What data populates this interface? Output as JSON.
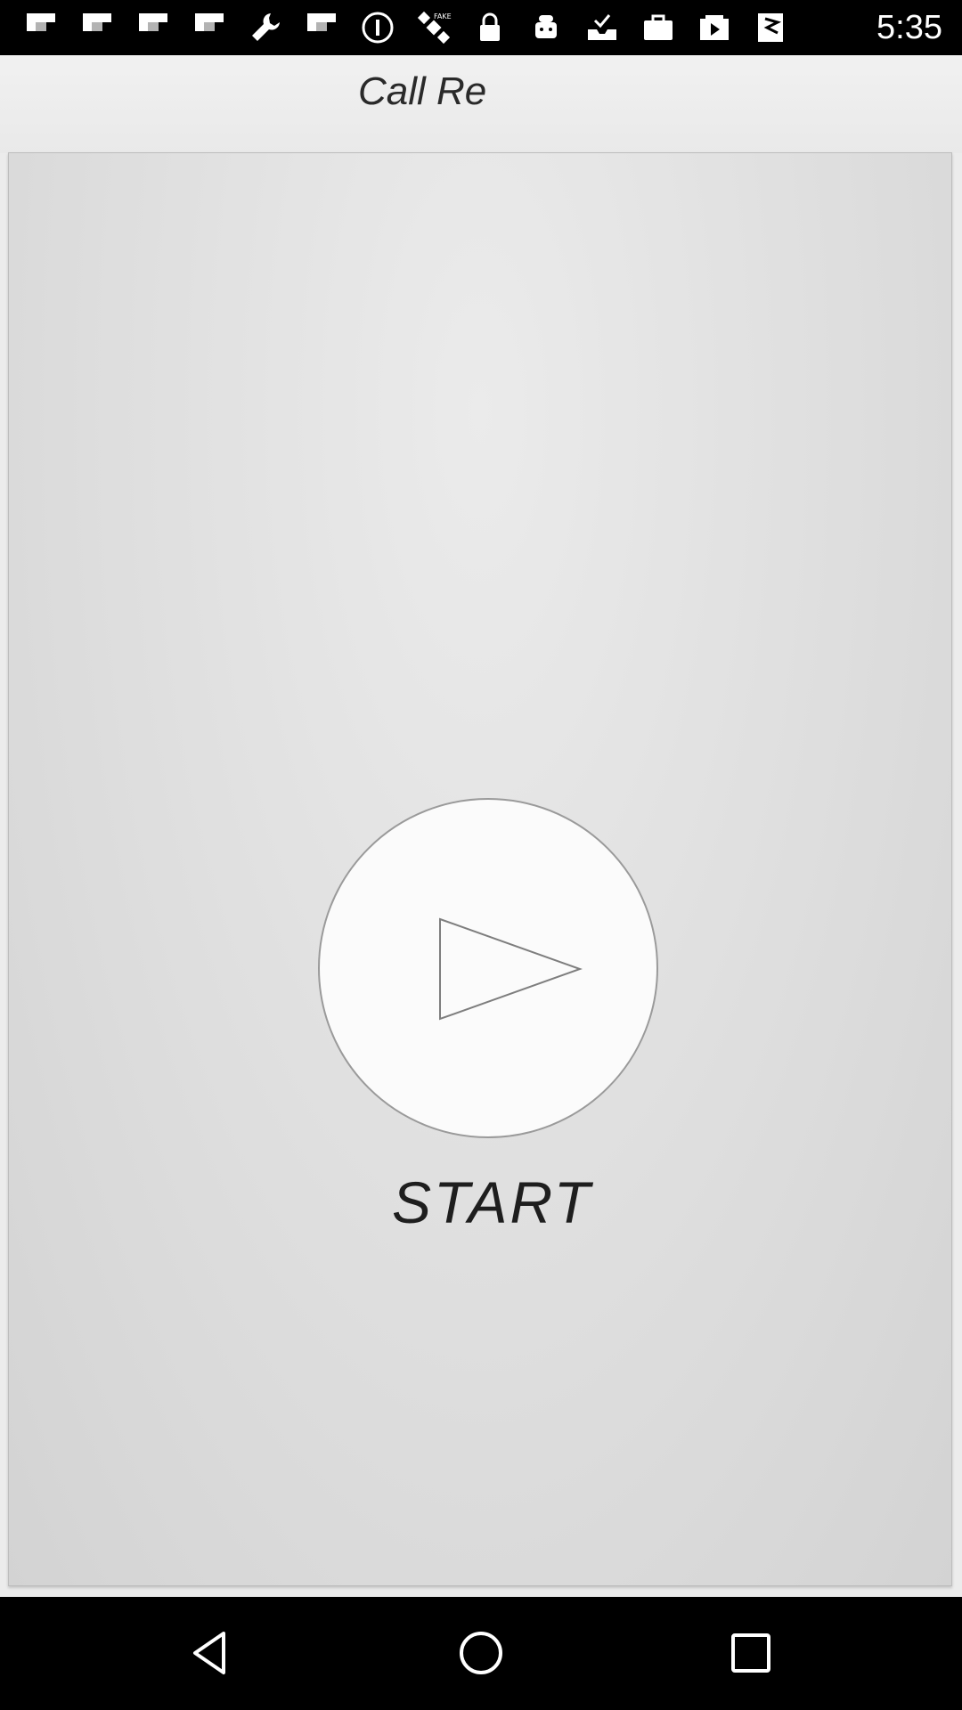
{
  "status_bar": {
    "time": "5:35",
    "icons": [
      "flipboard-icon",
      "flipboard-icon",
      "flipboard-icon",
      "flipboard-icon",
      "wrench-icon",
      "flipboard-icon",
      "info-circle-icon",
      "fake-gps-satellite-icon",
      "lock-icon",
      "android-robot-icon",
      "inbox-check-icon",
      "briefcase-icon",
      "play-store-icon",
      "flipboard-icon"
    ]
  },
  "app": {
    "title": "Call Re",
    "start_label": "START"
  },
  "nav_bar": {
    "buttons": [
      "back-icon",
      "home-icon",
      "recents-icon"
    ]
  },
  "colors": {
    "app_background": "#ececec",
    "panel_gradient_light": "#ebebeb",
    "panel_gradient_dark": "#d3d3d3",
    "button_fill": "#fbfbfb",
    "button_outline": "#9a9a9a",
    "text": "#1e1e1e"
  }
}
